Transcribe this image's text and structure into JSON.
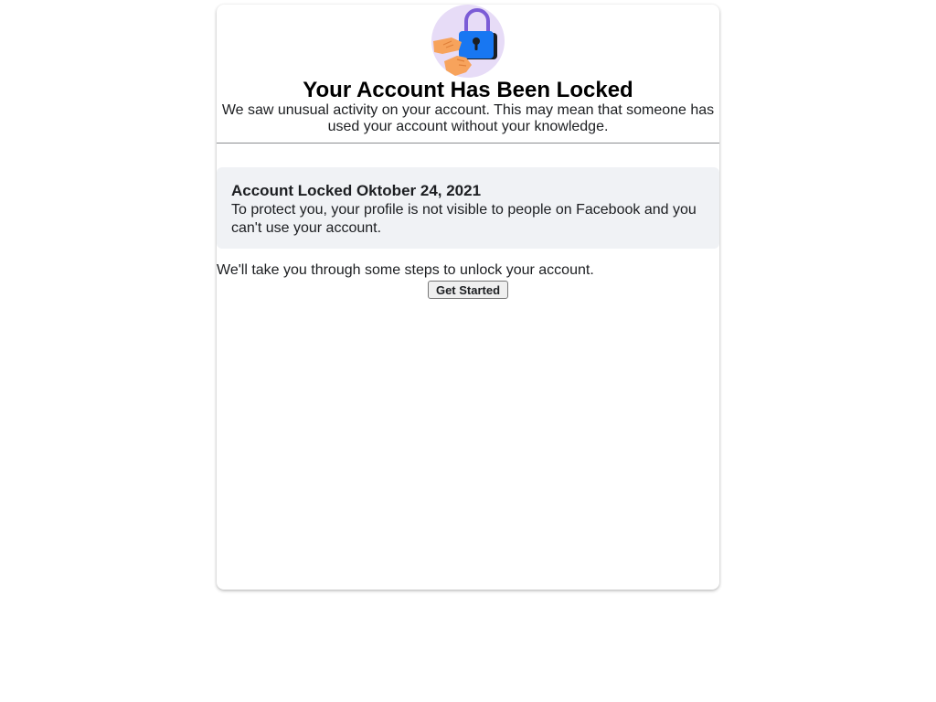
{
  "header": {
    "hero_icon": "locked-padlock-with-hands-icon",
    "title": "Your Account Has Been Locked",
    "intro": "We saw unusual activity on your account. This may mean that someone has used your account without your knowledge."
  },
  "notice": {
    "title": "Account Locked Oktober 24, 2021",
    "body": "To protect you, your profile is not visible to people on Facebook and you can't use your account."
  },
  "footer": {
    "steps_text": "We'll take you through some steps to unlock your account.",
    "button_label": "Get Started"
  },
  "colors": {
    "lock_blue": "#1877f2",
    "shackle_purple": "#7b5cd6",
    "circle_lavender": "#e7dcf7",
    "hand_orange": "#f7a35c",
    "notice_bg": "#f0f2f5"
  }
}
